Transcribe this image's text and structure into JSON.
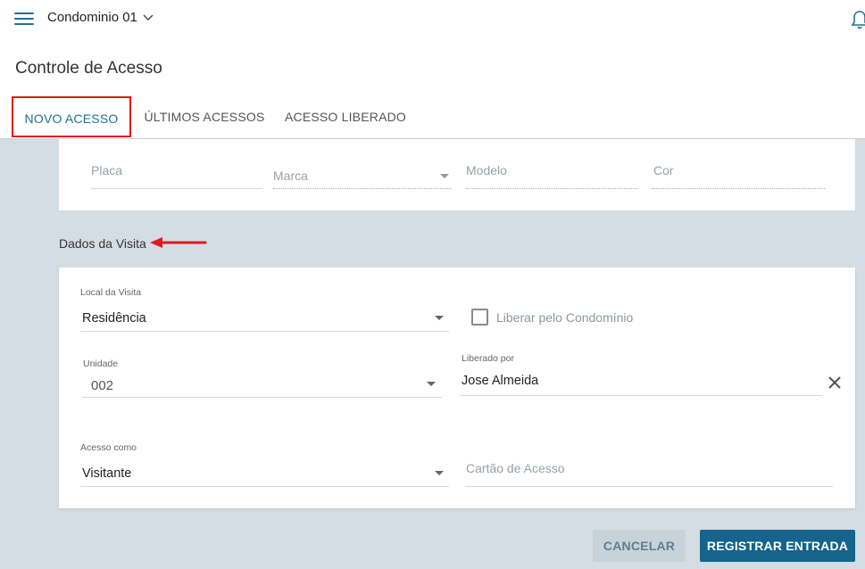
{
  "header": {
    "condo_name": "Condominio 01",
    "page_title": "Controle de Acesso"
  },
  "tabs": [
    {
      "label": "NOVO ACESSO",
      "active": true
    },
    {
      "label": "ÚLTIMOS ACESSOS",
      "active": false
    },
    {
      "label": "ACESSO LIBERADO",
      "active": false
    }
  ],
  "vehicle": {
    "placa_placeholder": "Placa",
    "marca_placeholder": "Marca",
    "modelo_placeholder": "Modelo",
    "cor_placeholder": "Cor"
  },
  "visit": {
    "section_title": "Dados da Visita",
    "local_label": "Local da Visita",
    "local_value": "Residência",
    "liberar_label": "Liberar pelo Condomínio",
    "unidade_label": "Unidade",
    "unidade_value": "002",
    "liberado_label": "Liberado por",
    "liberado_value": "Jose Almeida",
    "acesso_label": "Acesso como",
    "acesso_value": "Visitante",
    "cartao_placeholder": "Cartão de Acesso"
  },
  "actions": {
    "cancel_label": "CANCELAR",
    "submit_label": "REGISTRAR ENTRADA"
  },
  "colors": {
    "primary": "#14648c",
    "tab_highlight_border": "#e0191c",
    "background": "#d3dde3"
  },
  "icons": [
    "menu-icon",
    "chevron-down-icon",
    "bell-icon",
    "dropdown-caret-icon",
    "close-icon",
    "arrow-left-icon"
  ]
}
